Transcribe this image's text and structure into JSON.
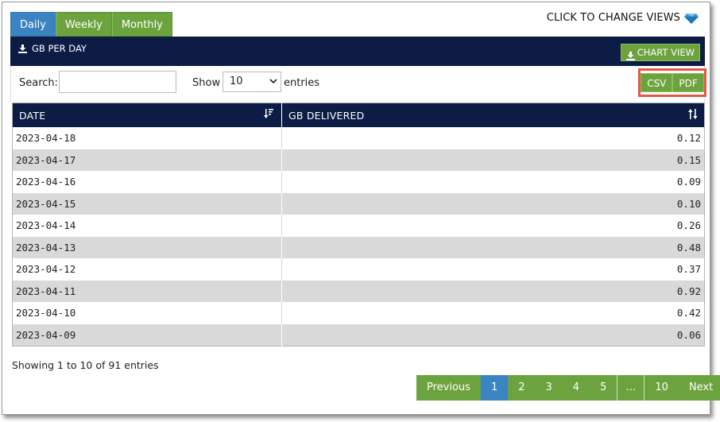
{
  "tabs": [
    {
      "label": "Daily",
      "active": true
    },
    {
      "label": "Weekly",
      "active": false
    },
    {
      "label": "Monthly",
      "active": false
    }
  ],
  "change_views_label": "CLICK TO CHANGE VIEWS",
  "panel": {
    "title": "GB PER DAY",
    "chart_view_label": "CHART VIEW"
  },
  "controls": {
    "search_label": "Search:",
    "search_value": "",
    "show_label": "Show",
    "entries_value": "10",
    "entries_label": "entries",
    "csv_label": "CSV",
    "pdf_label": "PDF"
  },
  "table": {
    "columns": [
      "DATE",
      "GB DELIVERED"
    ],
    "rows": [
      [
        "2023-04-18",
        "0.12"
      ],
      [
        "2023-04-17",
        "0.15"
      ],
      [
        "2023-04-16",
        "0.09"
      ],
      [
        "2023-04-15",
        "0.10"
      ],
      [
        "2023-04-14",
        "0.26"
      ],
      [
        "2023-04-13",
        "0.48"
      ],
      [
        "2023-04-12",
        "0.37"
      ],
      [
        "2023-04-11",
        "0.92"
      ],
      [
        "2023-04-10",
        "0.42"
      ],
      [
        "2023-04-09",
        "0.06"
      ]
    ]
  },
  "info": "Showing 1 to 10 of 91 entries",
  "pagination": {
    "previous": "Previous",
    "pages": [
      "1",
      "2",
      "3",
      "4",
      "5"
    ],
    "current": "1",
    "ellipsis": "…",
    "last": "10",
    "next": "Next"
  },
  "colors": {
    "accent_green": "#6da33e",
    "active_blue": "#3a84c2",
    "header_navy": "#0c1c45",
    "highlight_red": "#e8564a"
  },
  "icons": {
    "download": "download-icon",
    "gem": "diamond-icon",
    "sort": "sort-icon"
  }
}
